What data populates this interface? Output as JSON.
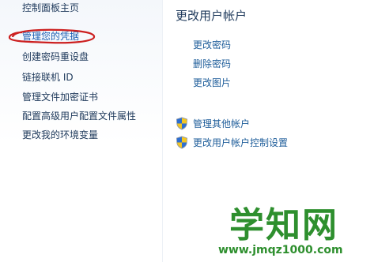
{
  "sidebar": {
    "home_label": "控制面板主页",
    "items": [
      {
        "label": "管理您的凭据"
      },
      {
        "label": "创建密码重设盘"
      },
      {
        "label": "链接联机 ID"
      },
      {
        "label": "管理文件加密证书"
      },
      {
        "label": "配置高级用户配置文件属性"
      },
      {
        "label": "更改我的环境变量"
      }
    ],
    "highlight_color": "#cc1f1f"
  },
  "main": {
    "title": "更改用户帐户",
    "links": [
      {
        "label": "更改密码"
      },
      {
        "label": "删除密码"
      },
      {
        "label": "更改图片"
      }
    ],
    "shield_links": [
      {
        "label": "管理其他帐户",
        "icon": "uac-shield-icon"
      },
      {
        "label": "更改用户帐户控制设置",
        "icon": "uac-shield-icon"
      }
    ]
  },
  "watermark": {
    "title": "学知网",
    "url": "www.jmqz1000.com"
  }
}
